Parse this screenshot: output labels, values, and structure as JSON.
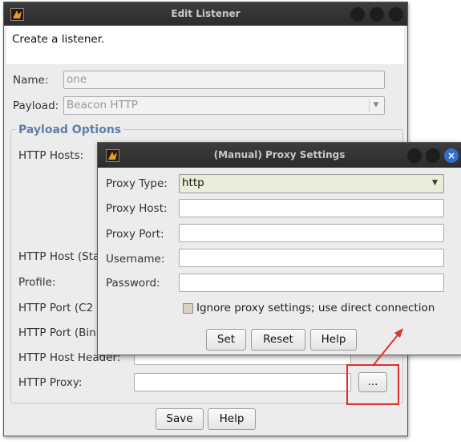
{
  "edit_listener": {
    "title": "Edit Listener",
    "description": "Create a listener.",
    "name_label": "Name:",
    "name_value": "one",
    "payload_label": "Payload:",
    "payload_value": "Beacon HTTP",
    "group_title": "Payload Options",
    "http_hosts_label": "HTTP Hosts:",
    "http_host_stager_label": "HTTP Host (Sta",
    "profile_label": "Profile:",
    "http_port_c2_label": "HTTP Port (C2",
    "http_port_bind_label": "HTTP Port (Bin",
    "http_host_header_label": "HTTP Host Header:",
    "http_proxy_label": "HTTP Proxy:",
    "http_proxy_value": "",
    "proxy_browse_label": "...",
    "save_label": "Save",
    "help_label": "Help"
  },
  "proxy_settings": {
    "title": "(Manual) Proxy Settings",
    "proxy_type_label": "Proxy Type:",
    "proxy_type_value": "http",
    "proxy_host_label": "Proxy Host:",
    "proxy_host_value": "",
    "proxy_port_label": "Proxy Port:",
    "proxy_port_value": "",
    "username_label": "Username:",
    "username_value": "",
    "password_label": "Password:",
    "password_value": "",
    "ignore_label": "Ignore proxy settings; use direct connection",
    "ignore_checked": false,
    "set_label": "Set",
    "reset_label": "Reset",
    "help_label": "Help",
    "close_glyph": "×"
  },
  "colors": {
    "group_title": "#5d7fa8",
    "annotation": "#e03030",
    "close_button": "#2f6fd2",
    "proxy_type_bg": "#e9ecd8"
  }
}
